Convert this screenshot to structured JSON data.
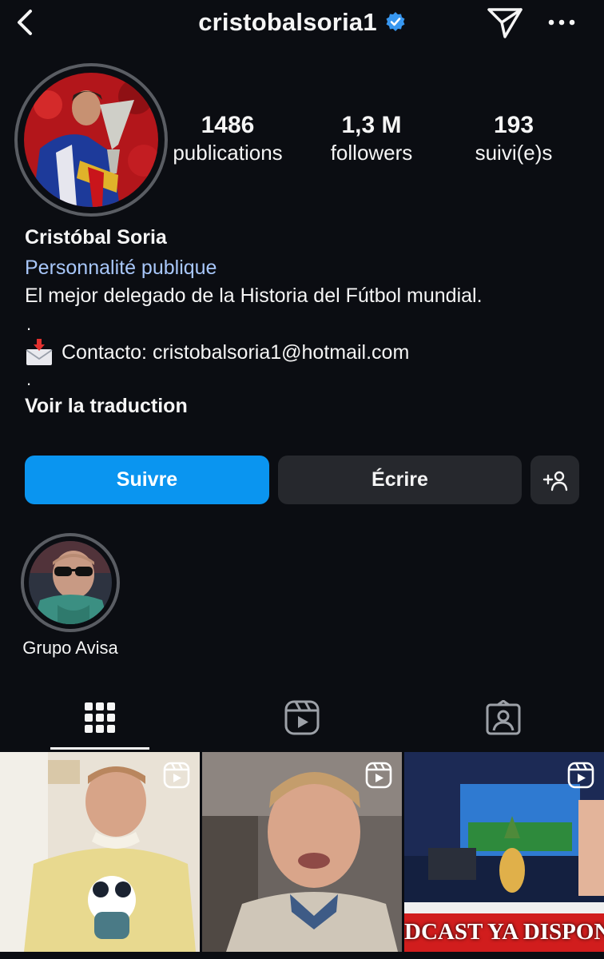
{
  "header": {
    "username": "cristobalsoria1",
    "verified": true,
    "back_icon": "chevron-left-icon",
    "send_icon": "paper-plane-icon",
    "more_icon": "more-horizontal-icon"
  },
  "stats": {
    "posts": {
      "value": "1486",
      "label": "publications"
    },
    "followers": {
      "value": "1,3 M",
      "label": "followers"
    },
    "following": {
      "value": "193",
      "label": "suivi(e)s"
    }
  },
  "profile": {
    "name": "Cristóbal Soria",
    "category": "Personnalité publique",
    "bio_line1": "El mejor delegado de la Historia del Fútbol mundial.",
    "bio_dot1": ".",
    "contact": "Contacto: cristobalsoria1@hotmail.com",
    "bio_dot2": ".",
    "translate": "Voir la traduction"
  },
  "actions": {
    "follow": "Suivre",
    "message": "Écrire",
    "add_user_icon": "add-user-icon"
  },
  "highlights": [
    {
      "label": "Grupo Avisa"
    }
  ],
  "tabs": [
    {
      "icon": "grid-icon",
      "active": true
    },
    {
      "icon": "reels-icon",
      "active": false
    },
    {
      "icon": "tagged-icon",
      "active": false
    }
  ],
  "posts": [
    {
      "type": "reel",
      "caption": ""
    },
    {
      "type": "reel",
      "caption": ""
    },
    {
      "type": "reel",
      "caption": "DCAST YA DISPONIBLE"
    }
  ],
  "colors": {
    "background": "#0b0d12",
    "follow_button": "#0a95f0",
    "secondary_button": "#26282d",
    "category_link": "#a8c7fa",
    "verified_badge": "#3897f0"
  }
}
